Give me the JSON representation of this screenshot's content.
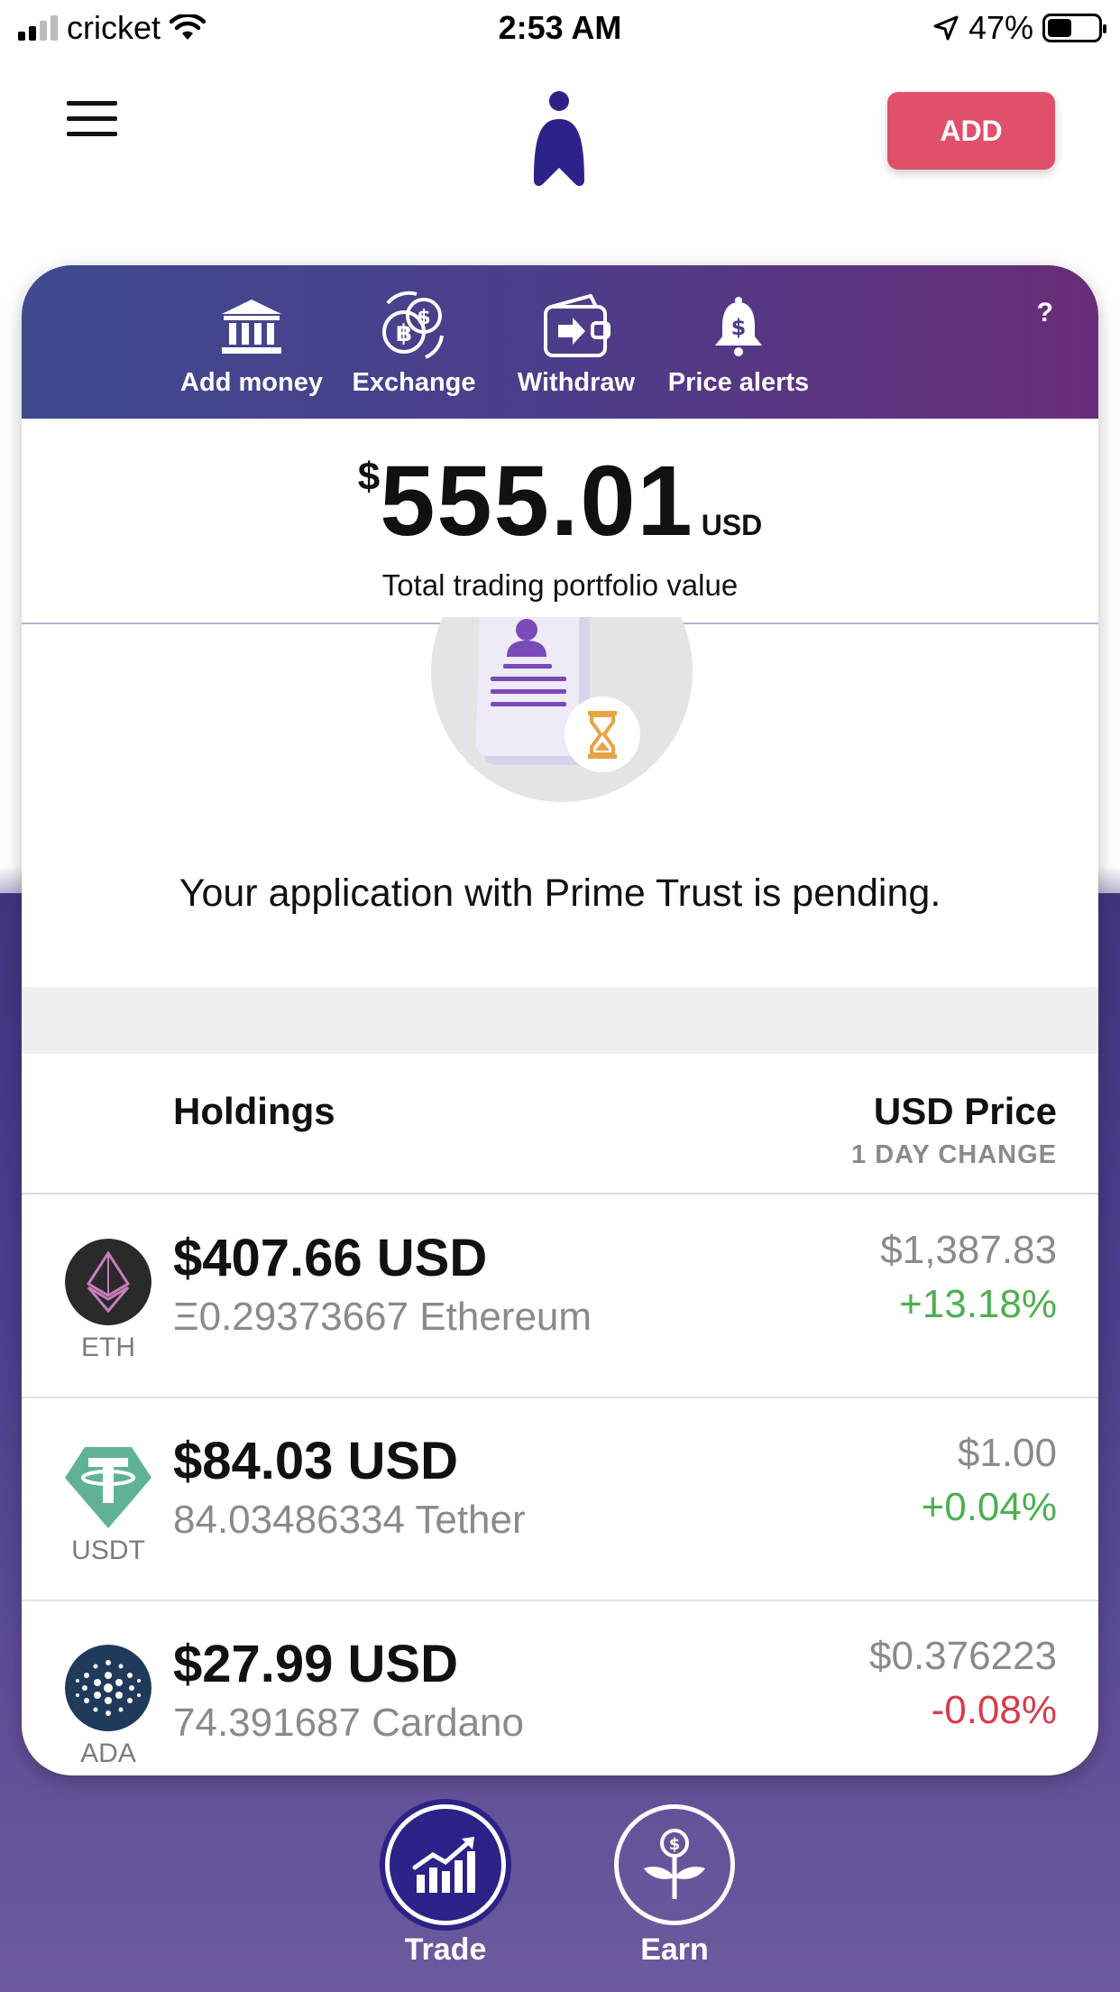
{
  "status_bar": {
    "carrier": "cricket",
    "time": "2:53 AM",
    "battery": "47%"
  },
  "header": {
    "add_label": "ADD"
  },
  "actions": [
    {
      "label": "Add money",
      "icon": "bank-icon"
    },
    {
      "label": "Exchange",
      "icon": "exchange-coins-icon"
    },
    {
      "label": "Withdraw",
      "icon": "withdraw-wallet-icon"
    },
    {
      "label": "Price alerts",
      "icon": "bell-dollar-icon"
    }
  ],
  "help_label": "?",
  "portfolio": {
    "currency_symbol": "$",
    "amount": "555.01",
    "unit": "USD",
    "caption": "Total trading portfolio value"
  },
  "pending": {
    "message": "Your application with Prime Trust is pending."
  },
  "holdings": {
    "title": "Holdings",
    "price_title": "USD Price",
    "change_title": "1 DAY CHANGE",
    "rows": [
      {
        "symbol": "ETH",
        "usd": "$407.66 USD",
        "qty": "Ξ0.29373667 Ethereum",
        "price": "$1,387.83",
        "change": "+13.18%",
        "direction": "up",
        "color": "#2a2a2a"
      },
      {
        "symbol": "USDT",
        "usd": "$84.03 USD",
        "qty": "84.03486334 Tether",
        "price": "$1.00",
        "change": "+0.04%",
        "direction": "up",
        "color": "#5fb394"
      },
      {
        "symbol": "ADA",
        "usd": "$27.99 USD",
        "qty": "74.391687 Cardano",
        "price": "$0.376223",
        "change": "-0.08%",
        "direction": "down",
        "color": "#1f3a5a"
      }
    ]
  },
  "bottom_nav": [
    {
      "label": "Trade",
      "icon": "chart-up-icon"
    },
    {
      "label": "Earn",
      "icon": "plant-dollar-icon"
    }
  ],
  "colors": {
    "accent_red": "#e0506a",
    "header_gradient_start": "#3f4a8f",
    "header_gradient_end": "#6a2c78",
    "positive": "#4caf50",
    "negative": "#d63c4a"
  }
}
